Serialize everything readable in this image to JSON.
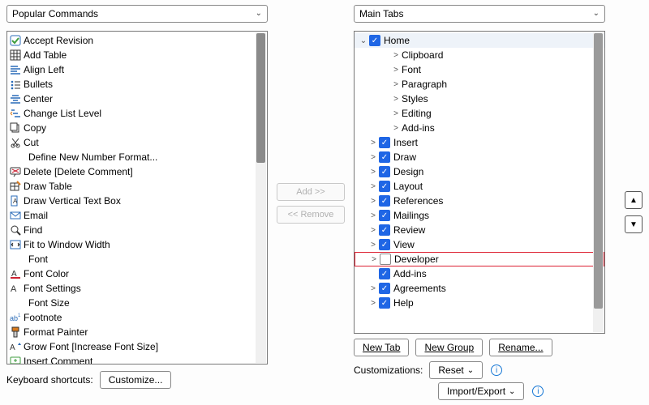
{
  "left_panel": {
    "dropdown": "Popular Commands",
    "commands": [
      {
        "icon": "accept",
        "label": "Accept Revision",
        "sub": ""
      },
      {
        "icon": "table",
        "label": "Add Table",
        "sub": ">"
      },
      {
        "icon": "align-left",
        "label": "Align Left",
        "sub": ""
      },
      {
        "icon": "bullets",
        "label": "Bullets",
        "sub": "|>"
      },
      {
        "icon": "center",
        "label": "Center",
        "sub": ""
      },
      {
        "icon": "list-level",
        "label": "Change List Level",
        "sub": ">"
      },
      {
        "icon": "copy",
        "label": "Copy",
        "sub": ""
      },
      {
        "icon": "cut",
        "label": "Cut",
        "sub": ""
      },
      {
        "icon": "",
        "label": "Define New Number Format...",
        "sub": "",
        "indent": true
      },
      {
        "icon": "delete-comment",
        "label": "Delete [Delete Comment]",
        "sub": ""
      },
      {
        "icon": "draw-table",
        "label": "Draw Table",
        "sub": ""
      },
      {
        "icon": "draw-vtb",
        "label": "Draw Vertical Text Box",
        "sub": ""
      },
      {
        "icon": "email",
        "label": "Email",
        "sub": ""
      },
      {
        "icon": "find",
        "label": "Find",
        "sub": ""
      },
      {
        "icon": "fit-window",
        "label": "Fit to Window Width",
        "sub": ""
      },
      {
        "icon": "",
        "label": "Font",
        "sub": "I▾",
        "indent": true
      },
      {
        "icon": "font-color",
        "label": "Font Color",
        "sub": "|>"
      },
      {
        "icon": "font-settings",
        "label": "Font Settings",
        "sub": ""
      },
      {
        "icon": "",
        "label": "Font Size",
        "sub": "I▾",
        "indent": true
      },
      {
        "icon": "footnote",
        "label": "Footnote",
        "sub": ""
      },
      {
        "icon": "format-painter",
        "label": "Format Painter",
        "sub": ""
      },
      {
        "icon": "grow-font",
        "label": "Grow Font [Increase Font Size]",
        "sub": ""
      },
      {
        "icon": "insert-comment",
        "label": "Insert Comment",
        "sub": ""
      }
    ],
    "keyboard_label": "Keyboard shortcuts:",
    "customize_btn": "Customize..."
  },
  "middle": {
    "add": "Add >>",
    "remove": "<< Remove"
  },
  "right_panel": {
    "dropdown": "Main Tabs",
    "tree": [
      {
        "lv": 0,
        "tw": "v",
        "cb": true,
        "label": "Home",
        "sel": true
      },
      {
        "lv": 2,
        "tw": ">",
        "label": "Clipboard"
      },
      {
        "lv": 2,
        "tw": ">",
        "label": "Font"
      },
      {
        "lv": 2,
        "tw": ">",
        "label": "Paragraph"
      },
      {
        "lv": 2,
        "tw": ">",
        "label": "Styles"
      },
      {
        "lv": 2,
        "tw": ">",
        "label": "Editing"
      },
      {
        "lv": 2,
        "tw": ">",
        "label": "Add-ins"
      },
      {
        "lv": 1,
        "tw": ">",
        "cb": true,
        "label": "Insert"
      },
      {
        "lv": 1,
        "tw": ">",
        "cb": true,
        "label": "Draw"
      },
      {
        "lv": 1,
        "tw": ">",
        "cb": true,
        "label": "Design"
      },
      {
        "lv": 1,
        "tw": ">",
        "cb": true,
        "label": "Layout"
      },
      {
        "lv": 1,
        "tw": ">",
        "cb": true,
        "label": "References"
      },
      {
        "lv": 1,
        "tw": ">",
        "cb": true,
        "label": "Mailings"
      },
      {
        "lv": 1,
        "tw": ">",
        "cb": true,
        "label": "Review"
      },
      {
        "lv": 1,
        "tw": ">",
        "cb": true,
        "label": "View"
      },
      {
        "lv": 1,
        "tw": ">",
        "cb": false,
        "label": "Developer",
        "hl": true
      },
      {
        "lv": 1,
        "tw": "",
        "cb": true,
        "label": "Add-ins"
      },
      {
        "lv": 1,
        "tw": ">",
        "cb": true,
        "label": "Agreements"
      },
      {
        "lv": 1,
        "tw": ">",
        "cb": true,
        "label": "Help"
      }
    ],
    "buttons": {
      "new_tab": "New Tab",
      "new_group": "New Group",
      "rename": "Rename..."
    },
    "customizations_label": "Customizations:",
    "reset": "Reset",
    "import_export": "Import/Export"
  }
}
